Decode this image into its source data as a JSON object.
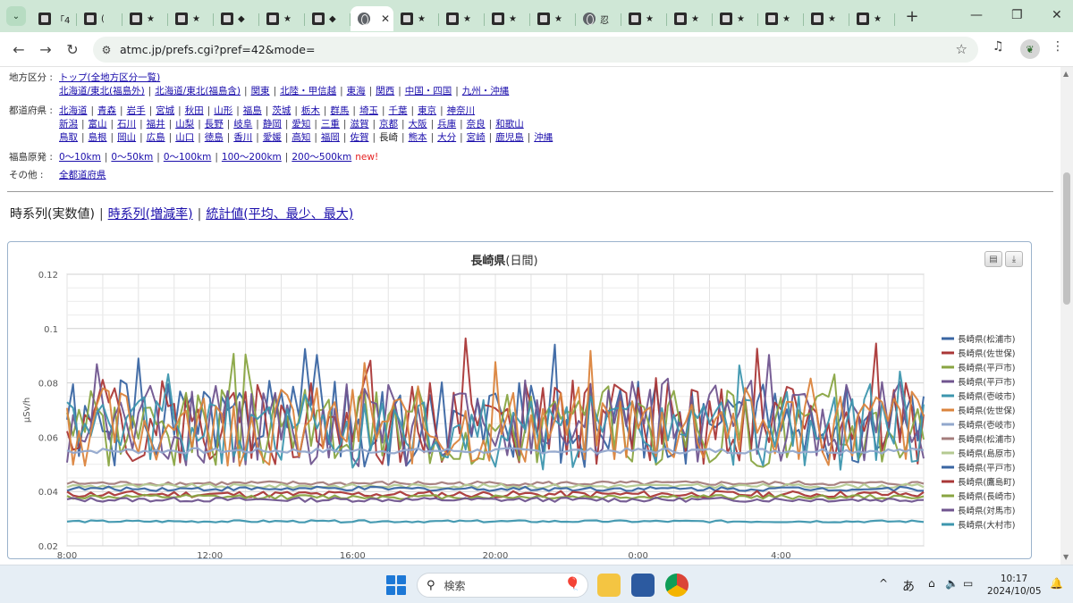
{
  "browser": {
    "active_tab_mark": "忍",
    "url": "atmc.jp/prefs.cgi?pref=42&mode="
  },
  "tabs": [
    {
      "mark": "「4"
    },
    {
      "mark": "("
    },
    {
      "mark": "★"
    },
    {
      "mark": "★"
    },
    {
      "mark": "◆"
    },
    {
      "mark": "★"
    },
    {
      "mark": "◆"
    },
    {
      "mark": "",
      "active": true
    },
    {
      "mark": "★"
    },
    {
      "mark": "★"
    },
    {
      "mark": "★"
    },
    {
      "mark": "★"
    },
    {
      "mark": "忍",
      "globe": true
    },
    {
      "mark": "★"
    },
    {
      "mark": "★"
    },
    {
      "mark": "★"
    },
    {
      "mark": "★"
    },
    {
      "mark": "★"
    },
    {
      "mark": "★"
    }
  ],
  "nav": {
    "region_label": "地方区分 :",
    "region_top": "トップ(全地方区分一覧)",
    "regions": [
      "北海道/東北(福島外)",
      "北海道/東北(福島含)",
      "関東",
      "北陸・甲信越",
      "東海",
      "関西",
      "中国・四国",
      "九州・沖縄"
    ],
    "pref_label": "都道府県 :",
    "prefs_row1": [
      "北海道",
      "青森",
      "岩手",
      "宮城",
      "秋田",
      "山形",
      "福島",
      "茨城",
      "栃木",
      "群馬",
      "埼玉",
      "千葉",
      "東京",
      "神奈川"
    ],
    "prefs_row2": [
      "新潟",
      "富山",
      "石川",
      "福井",
      "山梨",
      "長野",
      "岐阜",
      "静岡",
      "愛知",
      "三重",
      "滋賀",
      "京都",
      "大阪",
      "兵庫",
      "奈良",
      "和歌山"
    ],
    "prefs_row3": [
      "鳥取",
      "島根",
      "岡山",
      "広島",
      "山口",
      "徳島",
      "香川",
      "愛媛",
      "高知",
      "福岡",
      "佐賀",
      "長崎",
      "熊本",
      "大分",
      "宮崎",
      "鹿児島",
      "沖縄"
    ],
    "current_pref": "長崎",
    "fukushima_label": "福島原発 :",
    "fukushima": [
      "0～10km",
      "0～50km",
      "0～100km",
      "100～200km",
      "200～500km"
    ],
    "new_badge": "new!",
    "other_label": "その他 :",
    "other": "全都道府県"
  },
  "modes": {
    "current": "時系列(実数値)",
    "link1": "時系列(増減率)",
    "link2": "統計値(平均、最少、最大)"
  },
  "chart_data": {
    "type": "line",
    "title": "長崎県",
    "subtitle": "(日間)",
    "ylabel": "μSv/h",
    "ylim": [
      0.02,
      0.12
    ],
    "yticks": [
      "0.12",
      "0.1",
      "0.08",
      "0.06",
      "0.04",
      "0.02"
    ],
    "xticks": [
      "8:00",
      "12:00",
      "16:00",
      "20:00",
      "0:00",
      "4:00"
    ],
    "xlim_hours": [
      8,
      32
    ],
    "series": [
      {
        "name": "長崎県(松浦市)",
        "color": "#3a66a3",
        "base": 0.065,
        "amp": 0.016,
        "seed": 1
      },
      {
        "name": "長崎県(佐世保)",
        "color": "#aa3737",
        "base": 0.066,
        "amp": 0.016,
        "seed": 2
      },
      {
        "name": "長崎県(平戸市)",
        "color": "#89a542",
        "base": 0.064,
        "amp": 0.015,
        "seed": 3
      },
      {
        "name": "長崎県(平戸市)",
        "color": "#70558f",
        "base": 0.065,
        "amp": 0.016,
        "seed": 4
      },
      {
        "name": "長崎県(壱岐市)",
        "color": "#3d96ae",
        "base": 0.062,
        "amp": 0.014,
        "seed": 5
      },
      {
        "name": "長崎県(佐世保)",
        "color": "#db843d",
        "base": 0.064,
        "amp": 0.015,
        "seed": 6
      },
      {
        "name": "長崎県(壱岐市)",
        "color": "#92a8cd",
        "base": 0.055,
        "amp": 0.001,
        "seed": 7
      },
      {
        "name": "長崎県(松浦市)",
        "color": "#a47d7c",
        "base": 0.043,
        "amp": 0.0008,
        "seed": 8
      },
      {
        "name": "長崎県(島原市)",
        "color": "#b5ca92",
        "base": 0.042,
        "amp": 0.0008,
        "seed": 9
      },
      {
        "name": "長崎県(平戸市)",
        "color": "#3a66a3",
        "base": 0.041,
        "amp": 0.0008,
        "seed": 10
      },
      {
        "name": "長崎県(鷹島町)",
        "color": "#aa3737",
        "base": 0.039,
        "amp": 0.0012,
        "seed": 11
      },
      {
        "name": "長崎県(長崎市)",
        "color": "#89a542",
        "base": 0.038,
        "amp": 0.0008,
        "seed": 12
      },
      {
        "name": "長崎県(対馬市)",
        "color": "#70558f",
        "base": 0.037,
        "amp": 0.0008,
        "seed": 13
      },
      {
        "name": "長崎県(大村市)",
        "color": "#3d96ae",
        "base": 0.029,
        "amp": 0.0004,
        "seed": 14
      }
    ]
  },
  "taskbar": {
    "search_placeholder": "検索",
    "ime": "あ",
    "time": "10:17",
    "date": "2024/10/05"
  }
}
